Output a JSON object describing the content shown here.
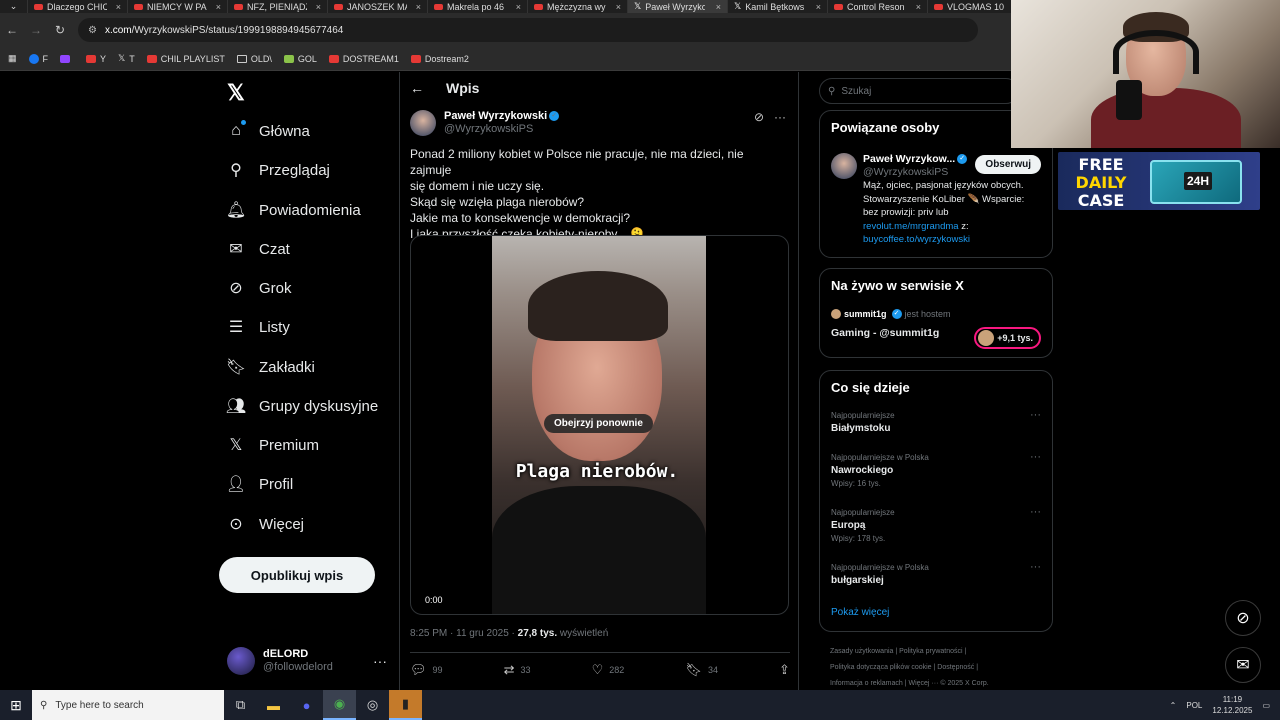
{
  "browser": {
    "tabs": [
      {
        "label": "Dlaczego CHIC",
        "icon": "youtube-icon"
      },
      {
        "label": "NIEMCY W PA",
        "icon": "youtube-icon"
      },
      {
        "label": "NFZ, PIENIĄDZ",
        "icon": "youtube-icon"
      },
      {
        "label": "JANOSZEK MA",
        "icon": "youtube-icon"
      },
      {
        "label": "Makrela po 46",
        "icon": "youtube-icon"
      },
      {
        "label": "Mężczyzna wy",
        "icon": "youtube-icon"
      },
      {
        "label": "Paweł Wyrzyko",
        "icon": "x-icon"
      },
      {
        "label": "Kamil Bętkows",
        "icon": "x-icon"
      },
      {
        "label": "Control Reson",
        "icon": "youtube-icon"
      },
      {
        "label": "VLOGMAS 10",
        "icon": "youtube-icon"
      }
    ],
    "url_domain": "x.com",
    "url_path": "/WyrzykowskiPS/status/1999198894945677464",
    "bookmarks": [
      {
        "label": "F",
        "icon": "facebook-icon"
      },
      {
        "label": "",
        "icon": "twitch-icon"
      },
      {
        "label": "Y",
        "icon": "youtube-icon"
      },
      {
        "label": "T",
        "icon": "x-icon"
      },
      {
        "label": "CHIL PLAYLIST",
        "icon": "youtube-icon"
      },
      {
        "label": "OLD\\",
        "icon": "folder-icon"
      },
      {
        "label": "GOL",
        "icon": "gol-icon"
      },
      {
        "label": "DOSTREAM1",
        "icon": "youtube-icon"
      },
      {
        "label": "Dostream2",
        "icon": "youtube-icon"
      }
    ]
  },
  "nav": {
    "items": [
      {
        "label": "Główna",
        "icon": "home-icon"
      },
      {
        "label": "Przeglądaj",
        "icon": "search-icon"
      },
      {
        "label": "Powiadomienia",
        "icon": "bell-icon"
      },
      {
        "label": "Czat",
        "icon": "mail-icon"
      },
      {
        "label": "Grok",
        "icon": "grok-icon"
      },
      {
        "label": "Listy",
        "icon": "list-icon"
      },
      {
        "label": "Zakładki",
        "icon": "bookmark-icon"
      },
      {
        "label": "Grupy dyskusyjne",
        "icon": "communities-icon"
      },
      {
        "label": "Premium",
        "icon": "x-icon"
      },
      {
        "label": "Profil",
        "icon": "person-icon"
      },
      {
        "label": "Więcej",
        "icon": "more-circle-icon"
      }
    ],
    "post_button": "Opublikuj wpis",
    "account": {
      "name": "dELORD",
      "handle": "@followdelord"
    }
  },
  "post": {
    "header_title": "Wpis",
    "author_name": "Paweł Wyrzykowski",
    "author_handle": "@WyrzykowskiPS",
    "text_lines": [
      "Ponad 2 miliony kobiet w Polsce nie pracuje, nie ma dzieci, nie zajmuje",
      "się domem i nie uczy się.",
      "Skąd się wzięła plaga nierobów?",
      "Jakie ma to konsekwencje w demokracji?",
      "I jaka przyszłość czeka kobiety-nieroby... 🫠"
    ],
    "video_rewatch": "Obejrzyj ponownie",
    "video_caption": "Plaga nierobów.",
    "video_time": "0:00",
    "timestamp": "8:25 PM · 11 gru 2025 · ",
    "views_count": "27,8 tys.",
    "views_label": " wyświetleń",
    "stats": {
      "replies": "99",
      "reposts": "33",
      "likes": "282",
      "bookmarks": "34"
    }
  },
  "sidebar": {
    "search_placeholder": "Szukaj",
    "related_title": "Powiązane osoby",
    "related_person": {
      "name": "Paweł Wyrzykow...",
      "handle": "@WyrzykowskiPS",
      "follow_label": "Obserwuj",
      "bio_1": "Mąż, ojciec, pasjonat języków obcych.",
      "bio_2": "Stowarzyszenie KoLiber 🪶 Wsparcie:",
      "bio_3": "bez prowizji: priv lub",
      "bio_link1": "revolut.me/mrgrandma",
      "bio_4": " z:",
      "bio_link2": "buycoffee.to/wyrzykowski"
    },
    "live_title": "Na żywo w serwisie X",
    "live": {
      "host": "summit1g",
      "host_suffix": "jest hostem",
      "title": "Gaming - @summit1g",
      "listeners": "+9,1 tys."
    },
    "trends_title": "Co się dzieje",
    "trends": [
      {
        "context": "Najpopularniejsze",
        "name": "Białymstoku",
        "posts": ""
      },
      {
        "context": "Najpopularniejsze w Polska",
        "name": "Nawrockiego",
        "posts": "Wpisy: 16 tys."
      },
      {
        "context": "Najpopularniejsze",
        "name": "Europą",
        "posts": "Wpisy: 178 tys."
      },
      {
        "context": "Najpopularniejsze w Polska",
        "name": "bułgarskiej",
        "posts": ""
      }
    ],
    "show_more": "Pokaż więcej",
    "footer_links": [
      "Zasady użytkowania",
      "Polityka prywatności",
      "Polityka dotycząca plików cookie",
      "Dostępność",
      "Informacja o reklamach",
      "Więcej ···",
      "© 2025 X Corp."
    ]
  },
  "overlay": {
    "promo_line1": "FREE",
    "promo_line2": "DAILY",
    "promo_line3": "CASE",
    "promo_badge": "24H"
  },
  "taskbar": {
    "search_placeholder": "Type here to search",
    "language": "POL",
    "time": "11:19",
    "date": "12.12.2025"
  }
}
